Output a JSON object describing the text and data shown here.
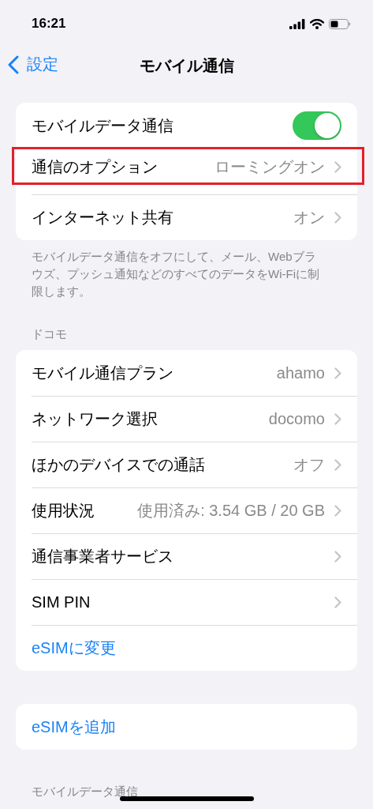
{
  "status_bar": {
    "time": "16:21"
  },
  "nav": {
    "back": "設定",
    "title": "モバイル通信"
  },
  "groups": [
    {
      "rows": [
        {
          "kind": "toggle",
          "label": "モバイルデータ通信",
          "on": true,
          "highlighted": false
        },
        {
          "kind": "link",
          "label": "通信のオプション",
          "value": "ローミングオン",
          "highlighted": true
        },
        {
          "kind": "link",
          "label": "インターネット共有",
          "value": "オン",
          "highlighted": false
        }
      ],
      "footer": "モバイルデータ通信をオフにして、メール、Webブラウズ、プッシュ通知などのすべてのデータをWi-Fiに制限します。"
    },
    {
      "header": "ドコモ",
      "rows": [
        {
          "kind": "link",
          "label": "モバイル通信プラン",
          "value": "ahamo",
          "highlighted": false
        },
        {
          "kind": "link",
          "label": "ネットワーク選択",
          "value": "docomo",
          "highlighted": false
        },
        {
          "kind": "link",
          "label": "ほかのデバイスでの通話",
          "value": "オフ",
          "highlighted": false
        },
        {
          "kind": "link",
          "label": "使用状況",
          "value": "使用済み: 3.54 GB / 20 GB",
          "highlighted": false
        },
        {
          "kind": "link",
          "label": "通信事業者サービス",
          "highlighted": false
        },
        {
          "kind": "link",
          "label": "SIM PIN",
          "highlighted": false
        },
        {
          "kind": "action",
          "label": "eSIMに変更",
          "highlighted": false
        }
      ]
    },
    {
      "rows": [
        {
          "kind": "action",
          "label": "eSIMを追加",
          "highlighted": false
        }
      ]
    },
    {
      "header": "モバイルデータ通信"
    }
  ]
}
